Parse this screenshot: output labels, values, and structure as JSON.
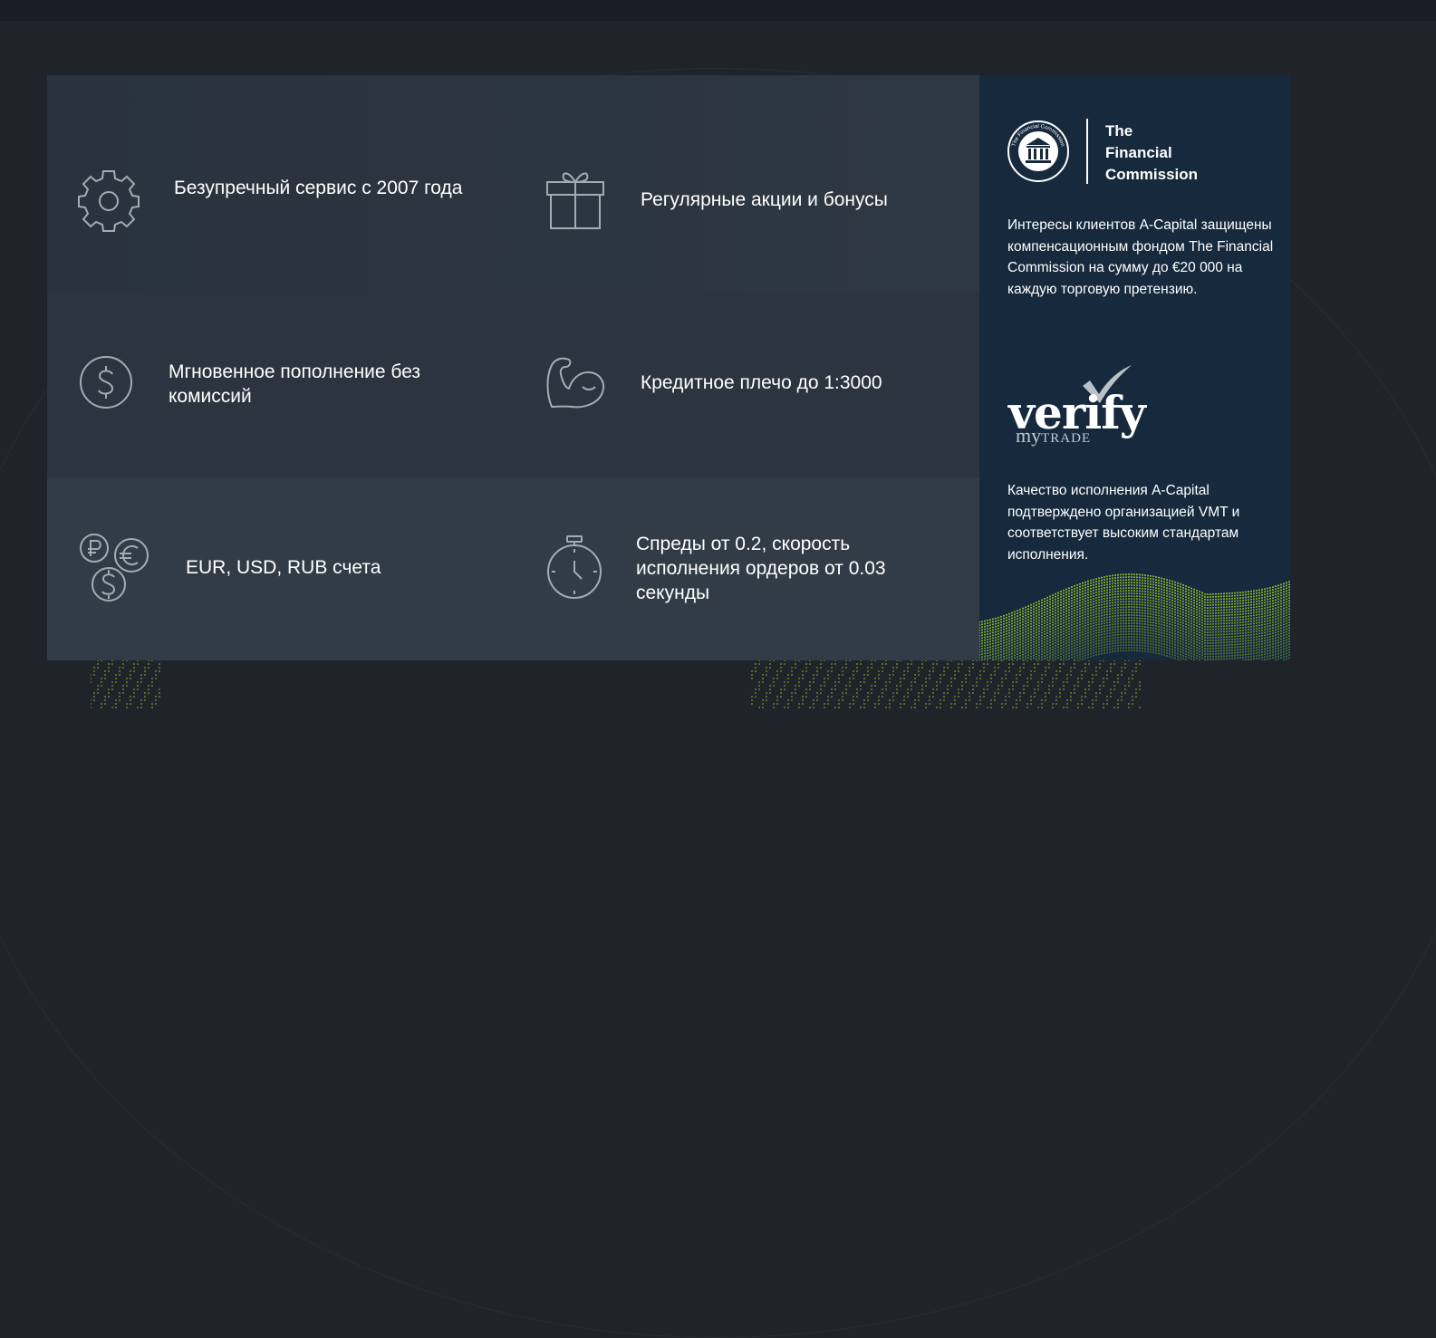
{
  "features": [
    {
      "icon": "gear-icon",
      "text": "Безупречный сервис с 2007 года"
    },
    {
      "icon": "gift-icon",
      "text": "Регулярные акции и бонусы"
    },
    {
      "icon": "dollar-coin-icon",
      "text": "Мгновенное пополнение без комиссий"
    },
    {
      "icon": "bicep-icon",
      "text": "Кредитное плечо до 1:3000"
    },
    {
      "icon": "currency-coins-icon",
      "text": "EUR, USD, RUB счета"
    },
    {
      "icon": "stopwatch-icon",
      "text": "Спреды от 0.2, скорость исполнения ордеров от 0.03 секунды"
    }
  ],
  "sidebar": {
    "fc_logo_ring_text": "The Financial Commission",
    "fc_name_line1": "The",
    "fc_name_line2": "Financial",
    "fc_name_line3": "Commission",
    "fc_text": "Интересы клиентов A-Capital защищены компенсационным фондом The Financial Commission на сумму до €20 000 на каждую торговую претензию.",
    "vmt_word": "verify",
    "vmt_my": "my",
    "vmt_trade": "TRADE",
    "vmt_text": "Качество исполнения A-Capital подтверждено  организацией VMT и соответствует высоким стандартам исполнения."
  },
  "colors": {
    "page_bg": "#1f242b",
    "panel_bg": "#2c353f",
    "sidebar_bg": "#16293d",
    "icon_stroke": "#a3acb5",
    "accent_green": "#9ccc2e"
  }
}
